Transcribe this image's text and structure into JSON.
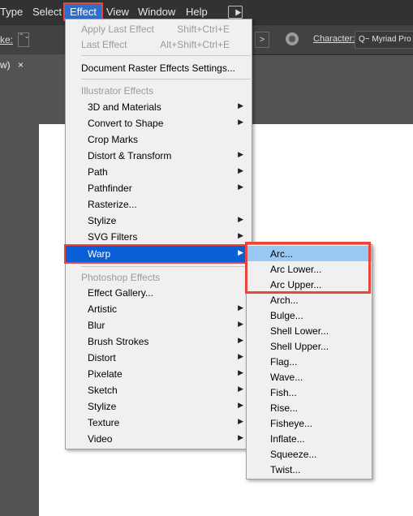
{
  "menubar": {
    "items": [
      "Type",
      "Select",
      "Effect",
      "View",
      "Window",
      "Help"
    ]
  },
  "controlbar": {
    "stroke_label": "ke:",
    "stepper_glyph": "⌃⌄",
    "next_glyph": ">",
    "character_label": "Character:",
    "character_value": "Q~ Myriad Pro"
  },
  "tab": {
    "label": "w)",
    "close": "×"
  },
  "effect_menu": {
    "apply_last": {
      "label": "Apply Last Effect",
      "shortcut": "Shift+Ctrl+E"
    },
    "last": {
      "label": "Last Effect",
      "shortcut": "Alt+Shift+Ctrl+E"
    },
    "doc_raster": "Document Raster Effects Settings...",
    "illustrator_header": "Illustrator Effects",
    "illustrator_items": [
      {
        "label": "3D and Materials",
        "sub": true
      },
      {
        "label": "Convert to Shape",
        "sub": true
      },
      {
        "label": "Crop Marks",
        "sub": false
      },
      {
        "label": "Distort & Transform",
        "sub": true
      },
      {
        "label": "Path",
        "sub": true
      },
      {
        "label": "Pathfinder",
        "sub": true
      },
      {
        "label": "Rasterize...",
        "sub": false
      },
      {
        "label": "Stylize",
        "sub": true
      },
      {
        "label": "SVG Filters",
        "sub": true
      },
      {
        "label": "Warp",
        "sub": true
      }
    ],
    "photoshop_header": "Photoshop Effects",
    "photoshop_items": [
      {
        "label": "Effect Gallery...",
        "sub": false
      },
      {
        "label": "Artistic",
        "sub": true
      },
      {
        "label": "Blur",
        "sub": true
      },
      {
        "label": "Brush Strokes",
        "sub": true
      },
      {
        "label": "Distort",
        "sub": true
      },
      {
        "label": "Pixelate",
        "sub": true
      },
      {
        "label": "Sketch",
        "sub": true
      },
      {
        "label": "Stylize",
        "sub": true
      },
      {
        "label": "Texture",
        "sub": true
      },
      {
        "label": "Video",
        "sub": true
      }
    ],
    "chevron": "▶"
  },
  "warp_menu": {
    "items": [
      "Arc...",
      "Arc Lower...",
      "Arc Upper...",
      "Arch...",
      "Bulge...",
      "Shell Lower...",
      "Shell Upper...",
      "Flag...",
      "Wave...",
      "Fish...",
      "Rise...",
      "Fisheye...",
      "Inflate...",
      "Squeeze...",
      "Twist..."
    ]
  }
}
